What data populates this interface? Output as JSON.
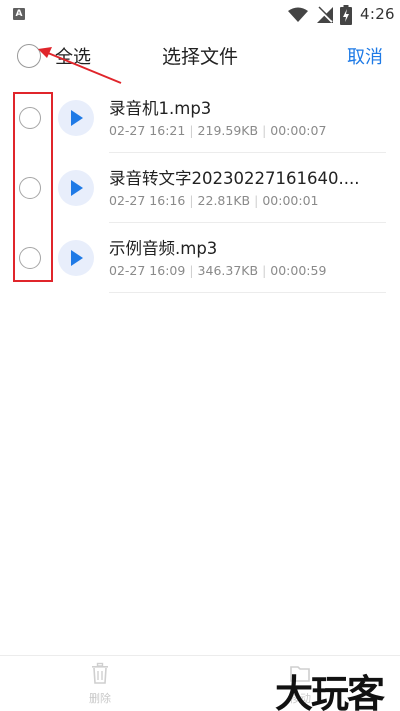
{
  "status_bar": {
    "badge": "A",
    "time": "4:26"
  },
  "header": {
    "select_all_label": "全选",
    "title": "选择文件",
    "cancel_label": "取消"
  },
  "files": [
    {
      "name": "录音机1.mp3",
      "date": "02-27 16:21",
      "size": "219.59KB",
      "duration": "00:00:07"
    },
    {
      "name": "录音转文字20230227161640....",
      "date": "02-27 16:16",
      "size": "22.81KB",
      "duration": "00:00:01"
    },
    {
      "name": "示例音频.mp3",
      "date": "02-27 16:09",
      "size": "346.37KB",
      "duration": "00:00:59"
    }
  ],
  "bottom_bar": {
    "delete_label": "删除",
    "move_label": "移动"
  },
  "watermark": "大玩客",
  "colors": {
    "accent": "#1e7ae6",
    "annotation": "#e0252b",
    "play_bg": "#e8eefb"
  }
}
